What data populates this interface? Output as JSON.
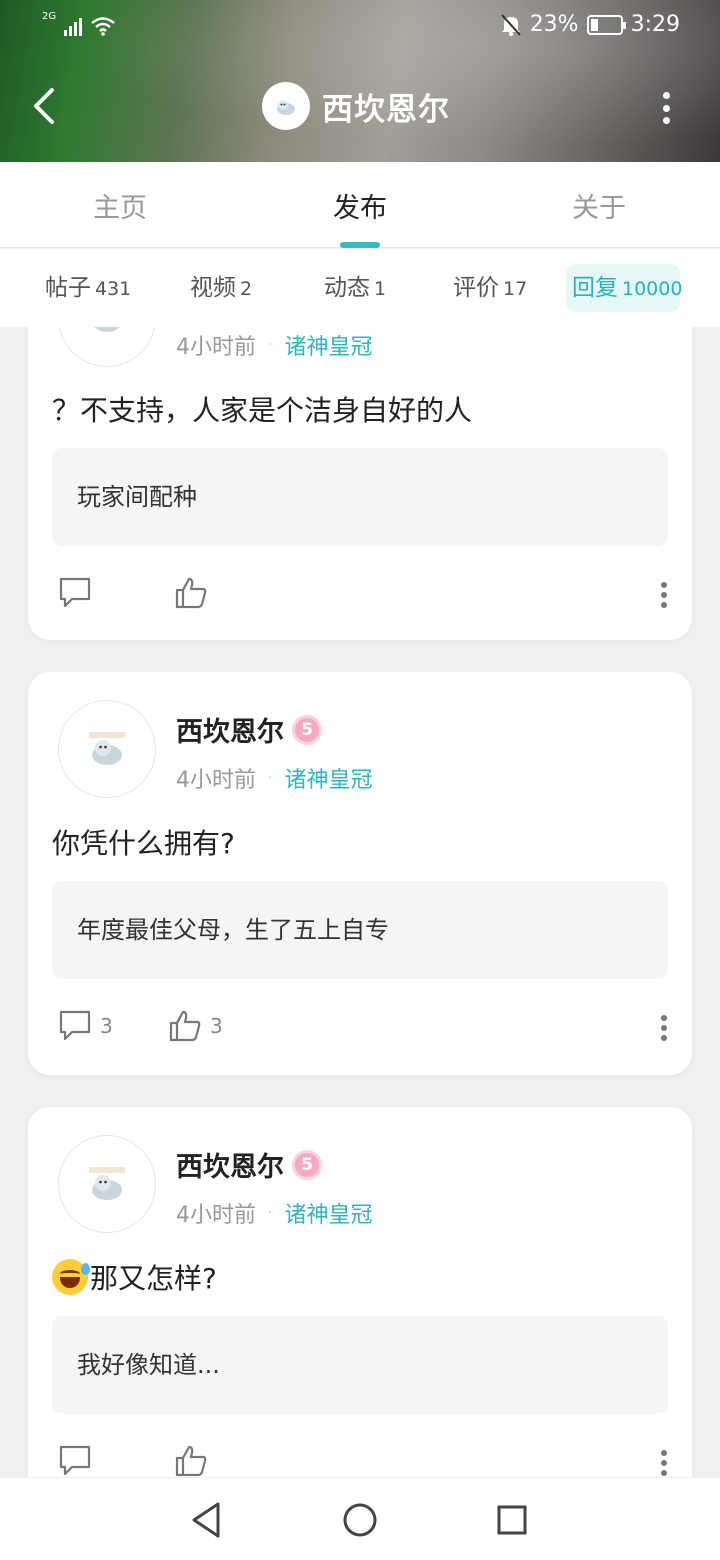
{
  "status_bar": {
    "network": "2G",
    "battery": "23%",
    "time": "3:29"
  },
  "header": {
    "title": "西坎恩尔"
  },
  "tabs": [
    {
      "label": "主页"
    },
    {
      "label": "发布"
    },
    {
      "label": "关于"
    }
  ],
  "subtabs": [
    {
      "label": "帖子",
      "count": "431"
    },
    {
      "label": "视频",
      "count": "2"
    },
    {
      "label": "动态",
      "count": "1"
    },
    {
      "label": "评价",
      "count": "17"
    },
    {
      "label": "回复",
      "count": "10000"
    }
  ],
  "posts": [
    {
      "time": "4小时前",
      "separator": "·",
      "forum": "诸神皇冠",
      "text": "？不支持，人家是个洁身自好的人",
      "quote": "玩家间配种",
      "comments": "",
      "likes": ""
    },
    {
      "username": "西坎恩尔",
      "level": "5",
      "time": "4小时前",
      "separator": "·",
      "forum": "诸神皇冠",
      "text": "你凭什么拥有?",
      "quote": "年度最佳父母，生了五上自专",
      "comments": "3",
      "likes": "3"
    },
    {
      "username": "西坎恩尔",
      "level": "5",
      "time": "4小时前",
      "separator": "·",
      "forum": "诸神皇冠",
      "text": "那又怎样?",
      "quote": "我好像知道...",
      "comments": "",
      "likes": ""
    }
  ]
}
